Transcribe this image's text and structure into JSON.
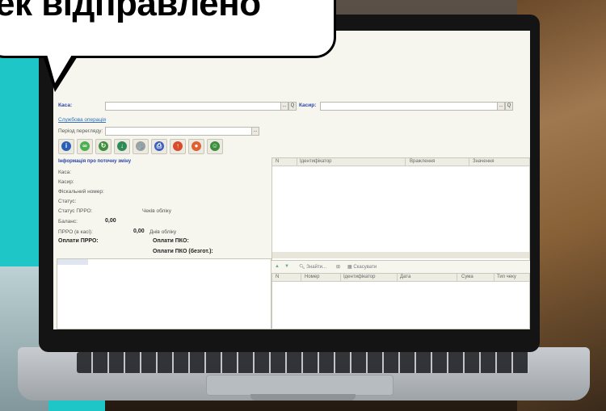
{
  "bubble": {
    "text": "ек відправлено"
  },
  "app": {
    "kasa_label": "Каса:",
    "kasyr_label": "Касир:",
    "kasa_btn": "...",
    "kasa_search": "Q",
    "kasyr_btn": "...",
    "kasyr_search": "Q",
    "service_ops_link": "Службова операція",
    "period_label": "Період перегляду:",
    "period_btn": "...",
    "toolbar_icons": [
      "info-icon",
      "open-shift-icon",
      "refresh-icon",
      "download-icon",
      "anchor-icon",
      "print-icon",
      "upload-icon",
      "stop-icon",
      "user-icon"
    ],
    "toolbar_glyphs": [
      "i",
      "∞",
      "↻",
      "↓",
      "⚓",
      "⎙",
      "↑",
      "●",
      "☺"
    ],
    "toolbar_colors": [
      "#2b5fb7",
      "#4caf50",
      "#3d8f3d",
      "#2e8b57",
      "#9e9e9e",
      "#3c5fc0",
      "#d84a2a",
      "#e06030",
      "#3b8e3b"
    ],
    "info": {
      "title": "Інформація про поточну зміну",
      "kasa": "Каса:",
      "kasyr": "Касир:",
      "fiscal": "Фіскальний номер:",
      "status": "Статус:",
      "status_prro": "Статус ПРРО:",
      "check_count": "Чеків обліку",
      "balance": "Баланс:",
      "balance_val": "0,00",
      "prro_kasa": "ПРРО (в касі):",
      "prro_val": "0,00",
      "days": "Днів обліку",
      "pay_prro": "Оплати ПРРО:",
      "pay_pko": "Оплати ПКО:",
      "pay_pko_bez": "Оплати ПКО (безгот.):"
    },
    "table1": {
      "columns": [
        "N",
        "Ідентифікатор",
        "Вражлення",
        "Значення"
      ]
    },
    "table2": {
      "toolbar": {
        "find": "Знайти...",
        "cancel": "Скасувати"
      },
      "columns": [
        "N",
        "Номер",
        "Ідентифікатор",
        "Дата",
        "Сума",
        "Тип чеку"
      ]
    }
  }
}
